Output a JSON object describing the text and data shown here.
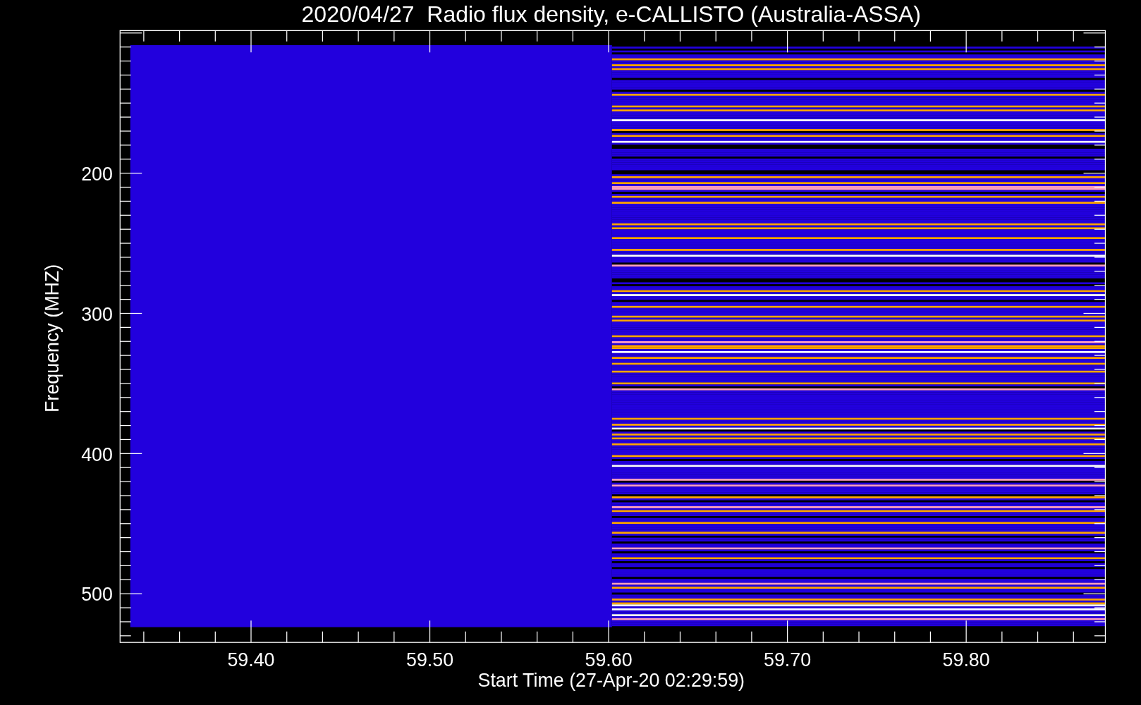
{
  "title": "2020/04/27  Radio flux density, e-CALLISTO (Australia-ASSA)",
  "y_axis": {
    "label": "Frequency (MHZ)",
    "ticks": [
      "200",
      "300",
      "400",
      "500"
    ]
  },
  "x_axis": {
    "label": "Start Time (27-Apr-20 02:29:59)",
    "ticks": [
      "59.40",
      "59.50",
      "59.60",
      "59.70",
      "59.80"
    ]
  }
}
